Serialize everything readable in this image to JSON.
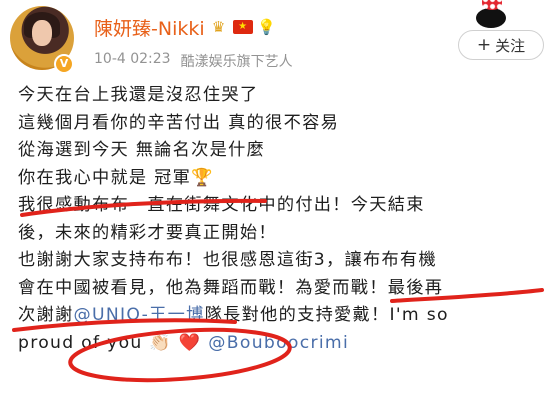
{
  "post": {
    "author_name": "陳妍臻-Nikki",
    "badges": [
      "crown-icon",
      "china-flag-icon",
      "lightbulb-icon"
    ],
    "timestamp": "10-4 02:23",
    "source": "酷漾娱乐旗下艺人",
    "follow_label": "关注",
    "follow_icon": "plus-icon",
    "lines": [
      "今天在台上我還是沒忍住哭了",
      "這幾個月看你的辛苦付出 真的很不容易",
      "從海選到今天 無論名次是什麼",
      "你在我心中就是 冠軍",
      "我很感動布布一直在街舞文化中的付出！今天結束",
      "後，未來的精彩才要真正開始！",
      "也謝謝大家支持布布！也很感恩這街3，讓布布有機",
      "會在中國被看見，他為舞蹈而戰！為愛而戰！最後再",
      "次謝謝",
      "隊長對他的支持愛戴！I'm so",
      "proud of you"
    ],
    "mention_1": "@UNIQ-王一博",
    "mention_2": "@Bouboocrimi",
    "trophy_glyph": "🏆",
    "clap_glyph": "👏🏻",
    "heart_glyph": "❤️"
  },
  "colors": {
    "username": "#e8611a",
    "mention": "#4a6ea9",
    "meta": "#939393",
    "annotation_red": "#e0231b"
  }
}
